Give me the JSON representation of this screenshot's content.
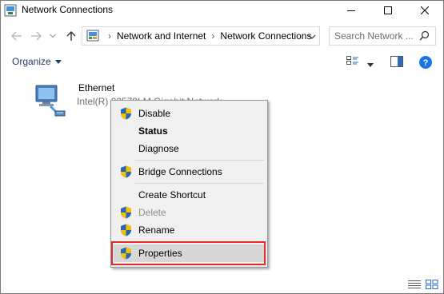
{
  "window": {
    "title": "Network Connections"
  },
  "nav": {
    "breadcrumb": [
      "Network and Internet",
      "Network Connections"
    ],
    "search_placeholder": "Search Network ..."
  },
  "commandbar": {
    "organize_label": "Organize"
  },
  "adapter": {
    "name": "Ethernet",
    "description": "Intel(R) 82579LM Gigabit Network"
  },
  "context_menu": {
    "items": [
      {
        "label": "Disable",
        "shield": true,
        "bold": false,
        "disabled": false
      },
      {
        "label": "Status",
        "shield": false,
        "bold": true,
        "disabled": false
      },
      {
        "label": "Diagnose",
        "shield": false,
        "bold": false,
        "disabled": false
      },
      {
        "label": "Bridge Connections",
        "shield": true,
        "bold": false,
        "disabled": false
      },
      {
        "label": "Create Shortcut",
        "shield": false,
        "bold": false,
        "disabled": false
      },
      {
        "label": "Delete",
        "shield": true,
        "bold": false,
        "disabled": true
      },
      {
        "label": "Rename",
        "shield": true,
        "bold": false,
        "disabled": false
      },
      {
        "label": "Properties",
        "shield": true,
        "bold": false,
        "disabled": false,
        "highlighted": true
      }
    ]
  },
  "colors": {
    "highlight_border": "#e32b2b",
    "link_blue": "#1e3f66",
    "help_blue": "#1a73e8"
  },
  "icons": {
    "title": "network-connections-icon",
    "adapter": "ethernet-adapter-icon",
    "menu_shield": "uac-shield-icon"
  }
}
